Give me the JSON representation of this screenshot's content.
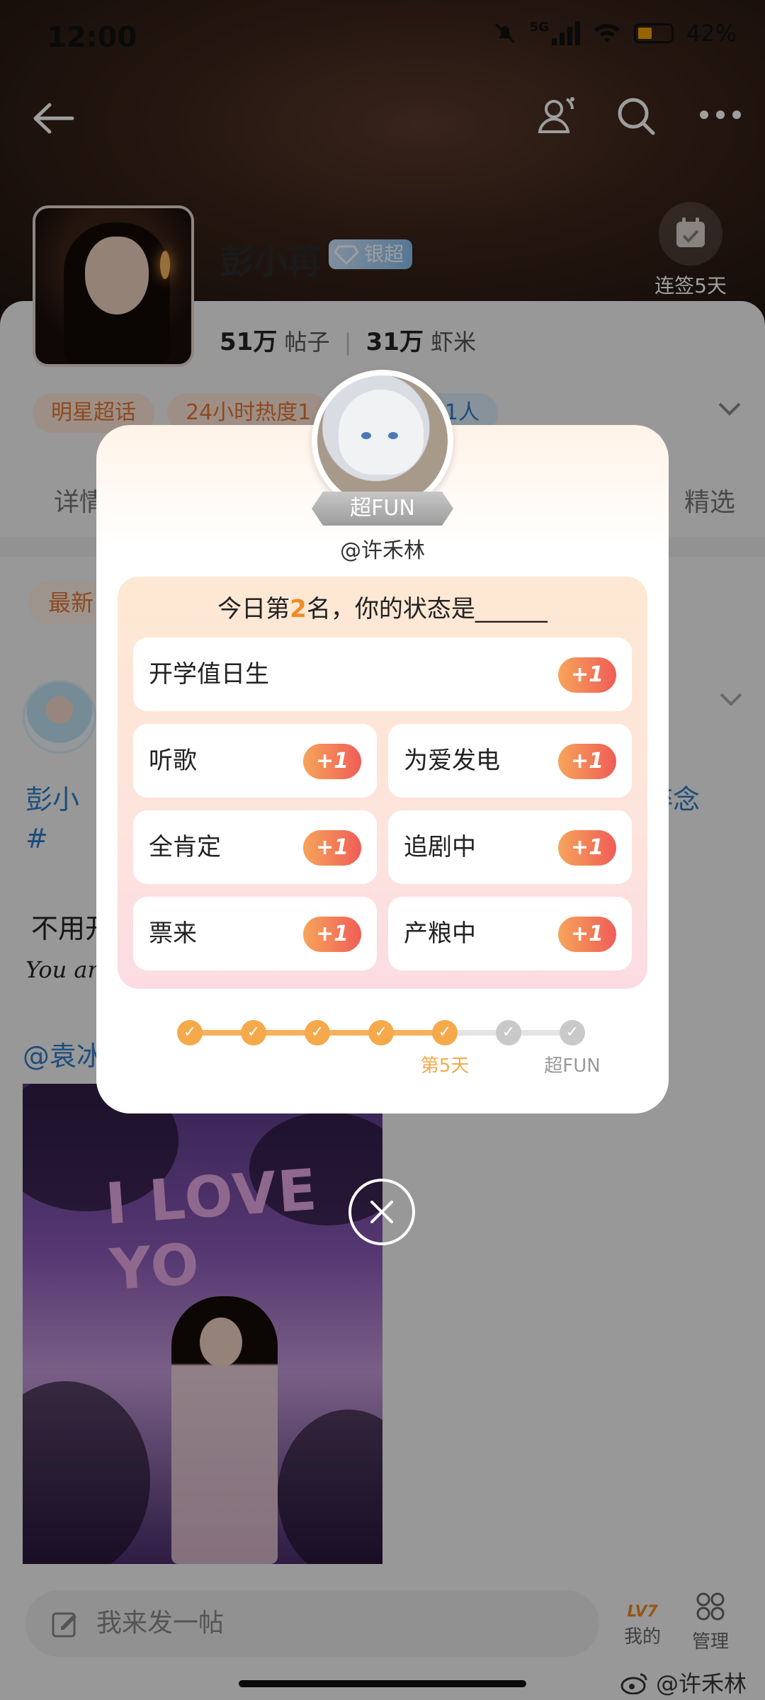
{
  "status_bar": {
    "time": "12:00",
    "network": "5G",
    "battery": "42%"
  },
  "topnav": {
    "back_icon": "back-arrow-icon",
    "icons": [
      "friends-icon",
      "search-icon",
      "more-icon"
    ]
  },
  "profile": {
    "name": "彭小苒",
    "badge": "银超",
    "posts_count": "51万",
    "posts_label": "帖子",
    "fans_count": "31万",
    "fans_label": "虾米",
    "checkin_label": "连签5天",
    "tags": [
      "明星超话",
      "24小时热度1",
      "丝钻咖 31人"
    ]
  },
  "tabs": {
    "left": "详情",
    "right": "精选"
  },
  "feed": {
    "filter_chip": "最新",
    "post_topic_start": "彭小",
    "post_topic_end": "碎念",
    "post_hash": "#",
    "post_text": "不用开",
    "post_script": "You ar",
    "mention": "@袁冰",
    "photo_text": "I LOVE YO"
  },
  "modal": {
    "ribbon": "超FUN",
    "handle": "@许禾林",
    "question_prefix": "今日第",
    "question_rank": "2",
    "question_suffix": "名，你的状态是______",
    "options": [
      {
        "label": "开学值日生",
        "action": "+1"
      },
      {
        "label": "听歌",
        "action": "+1"
      },
      {
        "label": "为爱发电",
        "action": "+1"
      },
      {
        "label": "全肯定",
        "action": "+1"
      },
      {
        "label": "追剧中",
        "action": "+1"
      },
      {
        "label": "票来",
        "action": "+1"
      },
      {
        "label": "产粮中",
        "action": "+1"
      }
    ],
    "progress": {
      "completed_steps": 5,
      "total_steps": 7,
      "current_label": "第5天",
      "final_label": "超FUN"
    }
  },
  "bottom": {
    "composer_placeholder": "我来发一帖",
    "level": "LV7",
    "mine_label": "我的",
    "manage_label": "管理"
  },
  "watermark": "@许禾林",
  "colors": {
    "accent_orange": "#f08a25",
    "badge_blue": "#2f7cc9",
    "plus_gradient_start": "#f6a45a",
    "plus_gradient_end": "#f05d57"
  }
}
